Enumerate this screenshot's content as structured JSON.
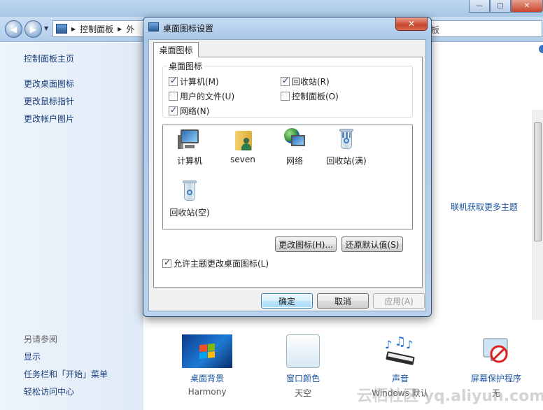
{
  "background_window": {
    "address_bar": {
      "segments": [
        "控制面板",
        "外"
      ],
      "tail_text": "板"
    },
    "window_buttons": {
      "minimize": "—",
      "maximize": "□",
      "close": "✕"
    },
    "sidebar": {
      "home_link": "控制面板主页",
      "links": [
        "更改桌面图标",
        "更改鼠标指针",
        "更改帐户图片"
      ],
      "see_also_heading": "另请参阅",
      "see_also_links": [
        "显示",
        "任务栏和「开始」菜单",
        "轻松访问中心"
      ]
    },
    "online_themes_link": "联机获取更多主题",
    "bottom_items": [
      {
        "label": "桌面背景",
        "value": "Harmony",
        "icon": "desktop-background-icon"
      },
      {
        "label": "窗口颜色",
        "value": "天空",
        "icon": "window-color-icon"
      },
      {
        "label": "声音",
        "value": "Windows 默认",
        "icon": "sound-icon"
      },
      {
        "label": "屏幕保护程序",
        "value": "无",
        "icon": "screensaver-icon"
      }
    ],
    "watermark": "云栖社区 yq.aliyun.com"
  },
  "dialog": {
    "title": "桌面图标设置",
    "close_label": "✕",
    "tab_label": "桌面图标",
    "group_legend": "桌面图标",
    "checkboxes": [
      {
        "label": "计算机(M)",
        "checked": true
      },
      {
        "label": "回收站(R)",
        "checked": true
      },
      {
        "label": "用户的文件(U)",
        "checked": false
      },
      {
        "label": "控制面板(O)",
        "checked": false
      },
      {
        "label": "网络(N)",
        "checked": true
      }
    ],
    "icons": [
      {
        "label": "计算机",
        "icon": "computer-icon"
      },
      {
        "label": "seven",
        "icon": "user-folder-icon"
      },
      {
        "label": "网络",
        "icon": "network-icon"
      },
      {
        "label": "回收站(满)",
        "icon": "recycle-bin-full-icon"
      },
      {
        "label": "回收站(空)",
        "icon": "recycle-bin-empty-icon"
      }
    ],
    "change_icon_button": "更改图标(H)...",
    "restore_default_button": "还原默认值(S)",
    "allow_themes_checkbox": {
      "label": "允许主题更改桌面图标(L)",
      "checked": true
    },
    "ok_button": "确定",
    "cancel_button": "取消",
    "apply_button": "应用(A)"
  }
}
